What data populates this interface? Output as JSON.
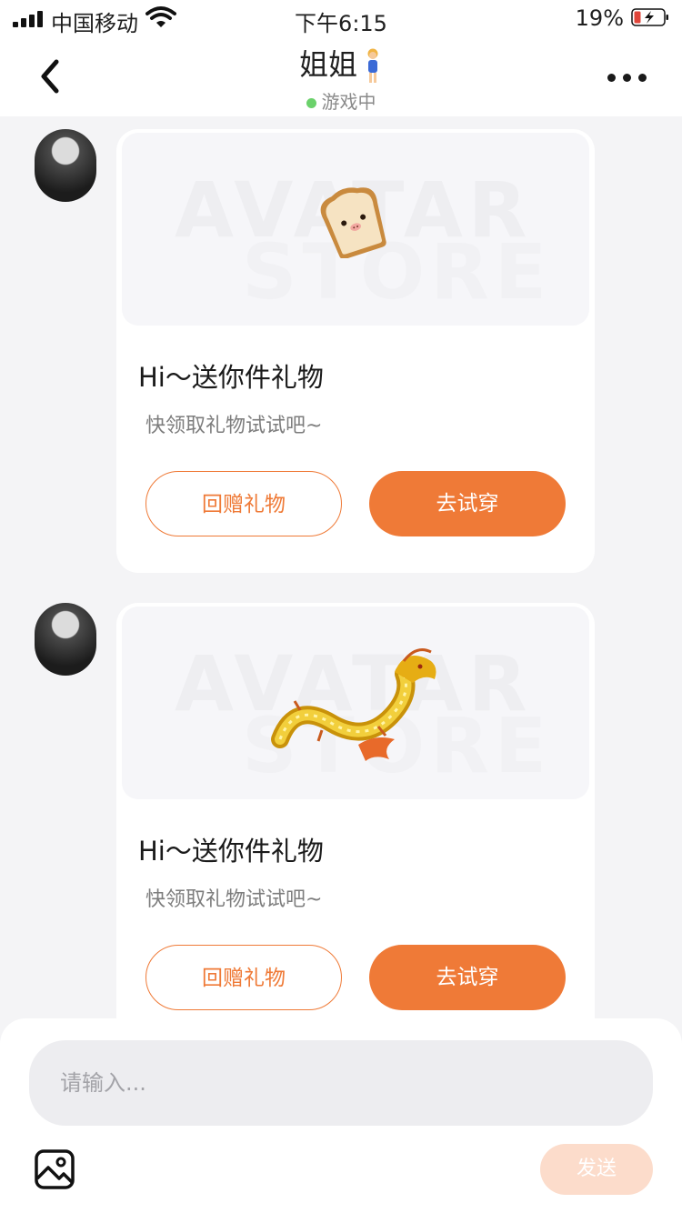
{
  "status_bar": {
    "carrier": "中国移动",
    "time": "下午6:15",
    "battery": "19%"
  },
  "nav": {
    "title": "姐姐",
    "status": "游戏中",
    "status_color": "#6bd16b"
  },
  "messages": [
    {
      "gift": "toast",
      "watermark_line1": "AVATAR",
      "watermark_line2": "STORE",
      "heading": "Hi～送你件礼物",
      "subtitle": "快领取礼物试试吧~",
      "return_gift_label": "回赠礼物",
      "try_on_label": "去试穿"
    },
    {
      "gift": "golden-dragon",
      "watermark_line1": "AVATAR",
      "watermark_line2": "STORE",
      "heading": "Hi～送你件礼物",
      "subtitle": "快领取礼物试试吧~",
      "return_gift_label": "回赠礼物",
      "try_on_label": "去试穿"
    }
  ],
  "composer": {
    "placeholder": "请输入...",
    "send_label": "发送"
  },
  "colors": {
    "accent": "#ef7a37",
    "send_disabled": "#fcdccb"
  }
}
